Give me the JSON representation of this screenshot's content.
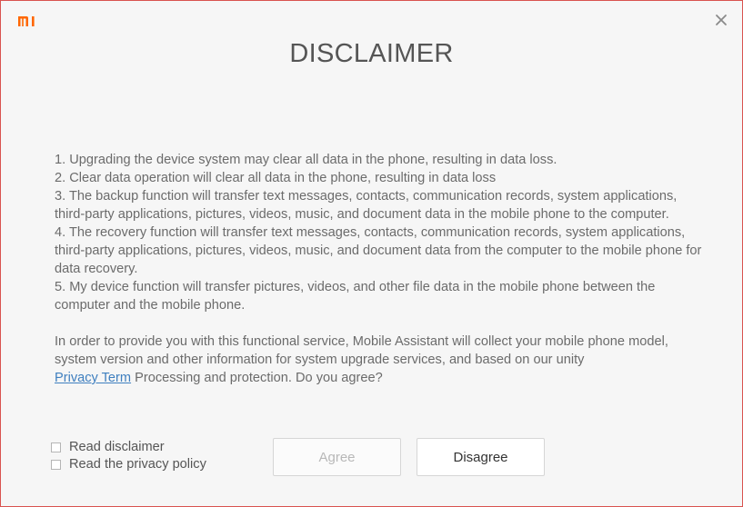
{
  "window": {
    "title": "DISCLAIMER",
    "logo_icon": "mi-logo-icon",
    "close_icon": "close-icon",
    "accent_color": "#ff6700"
  },
  "disclaimer": {
    "items": [
      "1. Upgrading the device system may clear all data in the phone, resulting in data loss.",
      "2. Clear data operation will clear all data in the phone, resulting in data loss",
      "3. The backup function will transfer text messages, contacts, communication records, system applications, third-party applications, pictures, videos, music, and document data in the mobile phone to the computer.",
      "4. The recovery function will transfer text messages, contacts, communication records, system applications, third-party applications, pictures, videos, music, and document data from the computer to the mobile phone for data recovery.",
      "5. My device function will transfer pictures, videos, and other file data in the mobile phone between the computer and the mobile phone."
    ],
    "notice_before": "In order to provide you with this functional service, Mobile Assistant will collect your mobile phone model, system version and other information for system upgrade services, and based on our unity",
    "privacy_link": "Privacy Term",
    "notice_after": " Processing and protection. Do you agree?"
  },
  "checkboxes": {
    "read_disclaimer": {
      "label": "Read disclaimer",
      "checked": false
    },
    "read_privacy": {
      "label": "Read the privacy policy",
      "checked": false
    }
  },
  "buttons": {
    "agree": "Agree",
    "disagree": "Disagree"
  }
}
